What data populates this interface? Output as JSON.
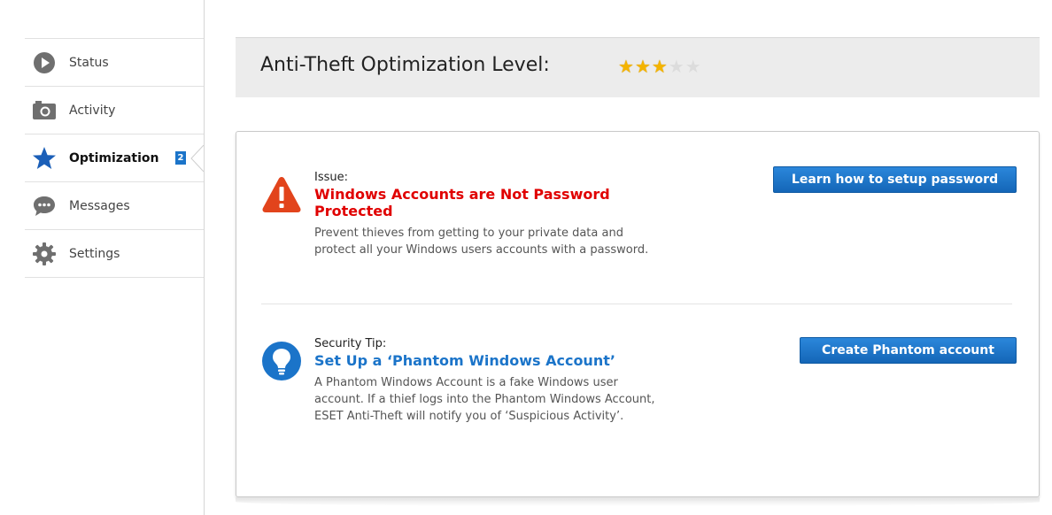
{
  "nav": {
    "items": [
      {
        "label": "Status",
        "icon": "play-circle-icon"
      },
      {
        "label": "Activity",
        "icon": "camera-icon"
      },
      {
        "label": "Optimization",
        "icon": "star-icon",
        "badge": "2",
        "active": true
      },
      {
        "label": "Messages",
        "icon": "chat-bubble-icon"
      },
      {
        "label": "Settings",
        "icon": "gear-icon"
      }
    ]
  },
  "header": {
    "title": "Anti-Theft Optimization Level:",
    "rating": {
      "value": 3,
      "max": 5
    }
  },
  "issue": {
    "kicker": "Issue:",
    "title": "Windows Accounts are Not Password Protected",
    "description": "Prevent thieves from getting to your private data and protect all your Windows users accounts with a password.",
    "button": "Learn how to setup password"
  },
  "tip": {
    "kicker": "Security Tip:",
    "title": "Set Up a ‘Phantom Windows Account’",
    "description": "A Phantom Windows Account is a fake Windows user account. If a thief logs into the Phantom Windows Account, ESET Anti-Theft will notify you of ‘Suspicious Activity’.",
    "button": "Create Phantom account"
  },
  "colors": {
    "accent": "#1b74c9",
    "issue": "#e00000",
    "warning_icon": "#e2441c",
    "star": "#f4b400"
  }
}
